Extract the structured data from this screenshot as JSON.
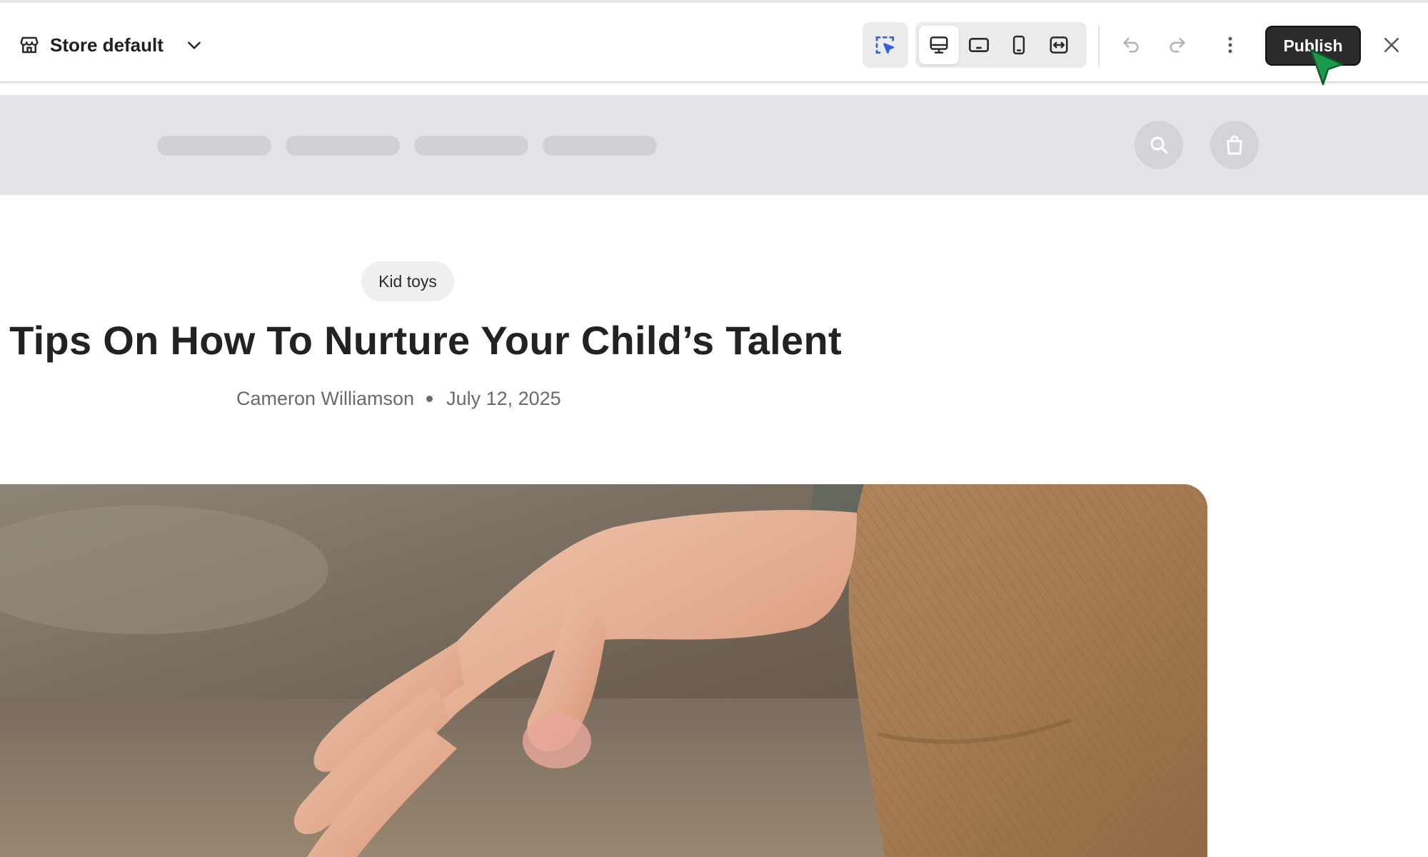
{
  "editor": {
    "store_name": "Store default",
    "publish_label": "Publish",
    "tools": [
      {
        "name": "select",
        "icon": "select-cursor-icon",
        "active": true
      },
      {
        "name": "desktop",
        "icon": "desktop-icon",
        "active": true
      },
      {
        "name": "tablet",
        "icon": "tablet-landscape-icon",
        "active": false
      },
      {
        "name": "mobile",
        "icon": "mobile-icon",
        "active": false
      },
      {
        "name": "full-width",
        "icon": "fullwidth-icon",
        "active": false
      }
    ],
    "colors": {
      "accent": "#2f62e6",
      "publish_bg": "#2b2b2b",
      "cursor": "#1a9a4a"
    }
  },
  "store_header": {
    "nav_placeholders": 4,
    "icons": [
      "search-icon",
      "shopping-bag-icon"
    ]
  },
  "article": {
    "category": "Kid toys",
    "title": "Tips On How To Nurture Your Child’s Talent",
    "author": "Cameron Williamson",
    "date": "July 12, 2025"
  }
}
